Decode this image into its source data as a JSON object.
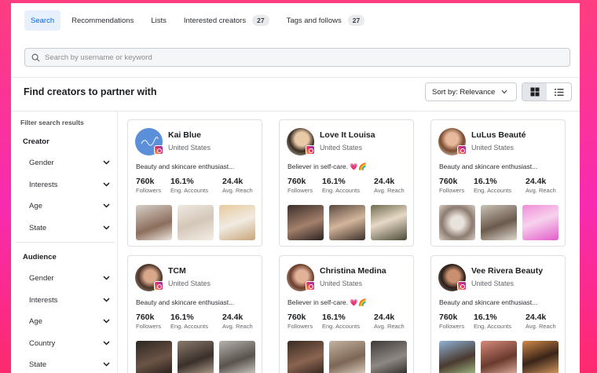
{
  "tabs": [
    {
      "label": "Search",
      "count": null,
      "active": true
    },
    {
      "label": "Recommendations",
      "count": null,
      "active": false
    },
    {
      "label": "Lists",
      "count": null,
      "active": false
    },
    {
      "label": "Interested creators",
      "count": "27",
      "active": false
    },
    {
      "label": "Tags and follows",
      "count": "27",
      "active": false
    }
  ],
  "search": {
    "placeholder": "Search by username or keyword",
    "value": ""
  },
  "header": {
    "title": "Find creators to partner with",
    "sort_label": "Sort by: Relevance"
  },
  "sidebar": {
    "title": "Filter search results",
    "creator": {
      "label": "Creator",
      "items": [
        "Gender",
        "Interests",
        "Age",
        "State"
      ]
    },
    "audience": {
      "label": "Audience",
      "items": [
        "Gender",
        "Interests",
        "Age",
        "Country",
        "State"
      ]
    }
  },
  "stat_labels": {
    "followers": "Followers",
    "eng": "Eng. Accounts",
    "reach": "Avg. Reach"
  },
  "creators": [
    {
      "name": "Kai Blue",
      "location": "United States",
      "bio": "Beauty and skincare enthusiast...",
      "followers": "760k",
      "eng": "16.1%",
      "reach": "24.4k"
    },
    {
      "name": "Love It Louisa",
      "location": "United States",
      "bio": "Believer in self-care. 💗🌈",
      "followers": "760k",
      "eng": "16.1%",
      "reach": "24.4k"
    },
    {
      "name": "LuLus Beauté",
      "location": "United States",
      "bio": "Beauty and skincare enthusiast...",
      "followers": "760k",
      "eng": "16.1%",
      "reach": "24.4k"
    },
    {
      "name": "TCM",
      "location": "United States",
      "bio": "Beauty and skincare enthusiast...",
      "followers": "760k",
      "eng": "16.1%",
      "reach": "24.4k"
    },
    {
      "name": "Christina Medina",
      "location": "United States",
      "bio": "Believer in self-care. 💗🌈",
      "followers": "760k",
      "eng": "16.1%",
      "reach": "24.4k"
    },
    {
      "name": "Vee Rivera Beauty",
      "location": "United States",
      "bio": "Beauty and skincare enthusiast...",
      "followers": "760k",
      "eng": "16.1%",
      "reach": "24.4k"
    }
  ],
  "colors": {
    "accent": "#0866d8",
    "active_tab_bg": "#e7f0fc",
    "frame_gradient": [
      "#ff3d7f",
      "#f72bb0"
    ]
  }
}
